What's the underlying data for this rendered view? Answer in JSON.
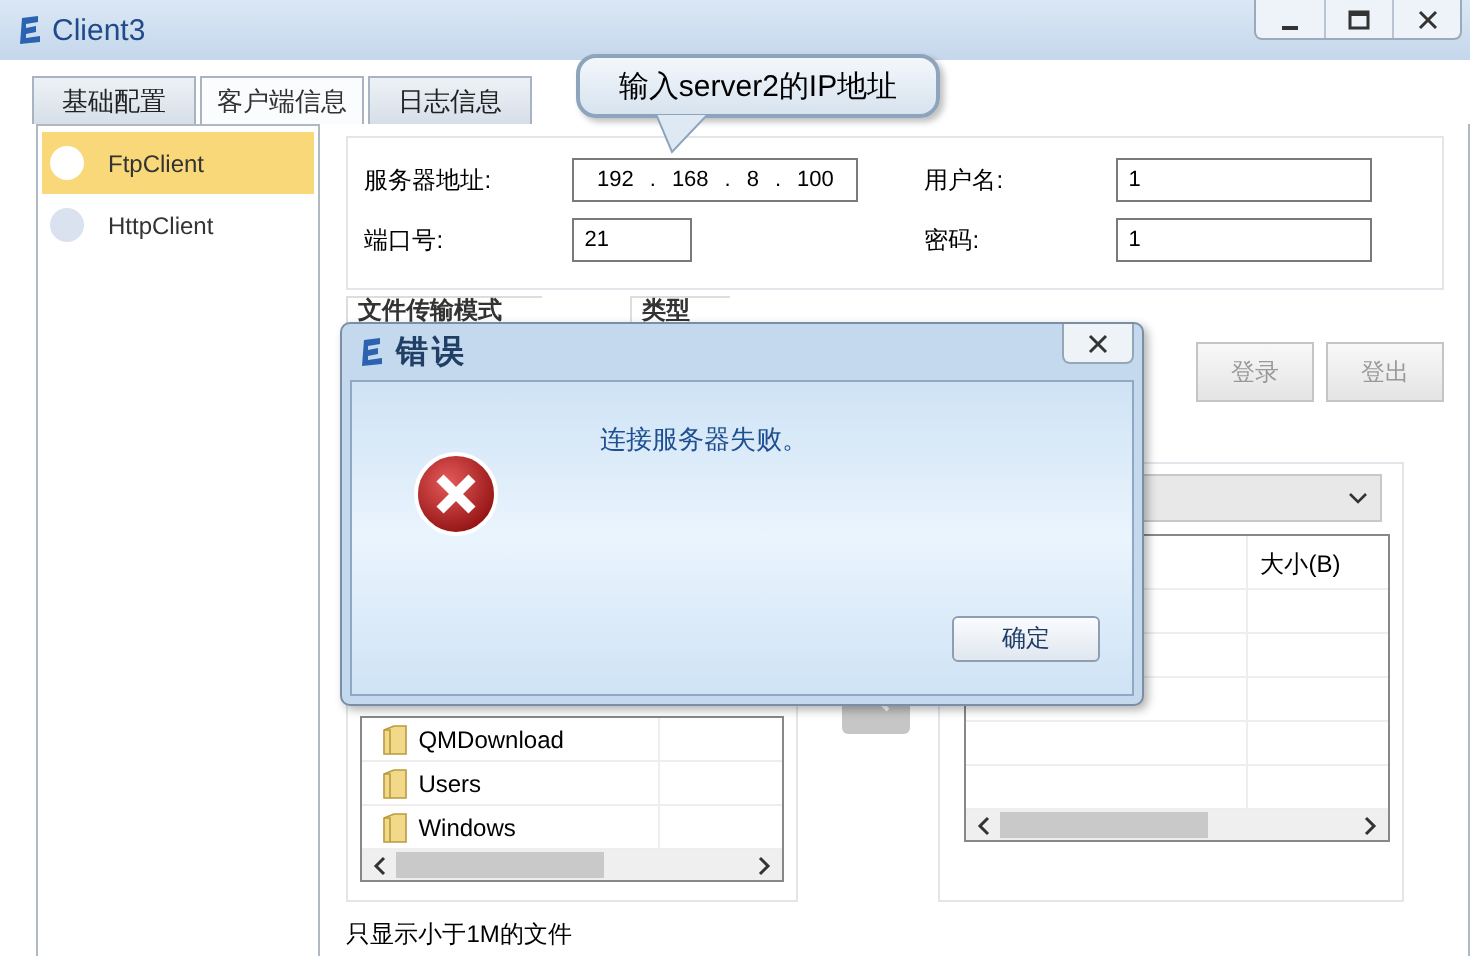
{
  "window": {
    "title": "Client3"
  },
  "tabs": [
    {
      "label": "基础配置",
      "selected": false
    },
    {
      "label": "客户端信息",
      "selected": true
    },
    {
      "label": "日志信息",
      "selected": false
    }
  ],
  "sidebar": {
    "items": [
      {
        "label": "FtpClient",
        "selected": true
      },
      {
        "label": "HttpClient",
        "selected": false
      }
    ]
  },
  "server_form": {
    "fields": [
      {
        "label": "服务器地址:",
        "kind": "ip",
        "separator": ".",
        "octets": [
          "192",
          "168",
          "8",
          "100"
        ]
      },
      {
        "label": "用户名:",
        "kind": "text",
        "value": "1"
      },
      {
        "label": "端口号:",
        "kind": "short",
        "value": "21"
      },
      {
        "label": "密码:",
        "kind": "text",
        "value": "1"
      }
    ]
  },
  "transfer_mode": {
    "label": "文件传输模式"
  },
  "type_group": {
    "label": "类型"
  },
  "buttons": [
    {
      "label": "登录",
      "disabled": true
    },
    {
      "label": "登出",
      "disabled": true
    }
  ],
  "local_files": {
    "rows": [
      "QMDownload",
      "Users",
      "Windows"
    ]
  },
  "remote_files": {
    "columns": [
      "大小(B)"
    ]
  },
  "note": "只显示小于1M的文件",
  "callout": "输入server2的IP地址",
  "dialog": {
    "title": "错误",
    "message": "连接服务器失败。",
    "button": "确定"
  }
}
